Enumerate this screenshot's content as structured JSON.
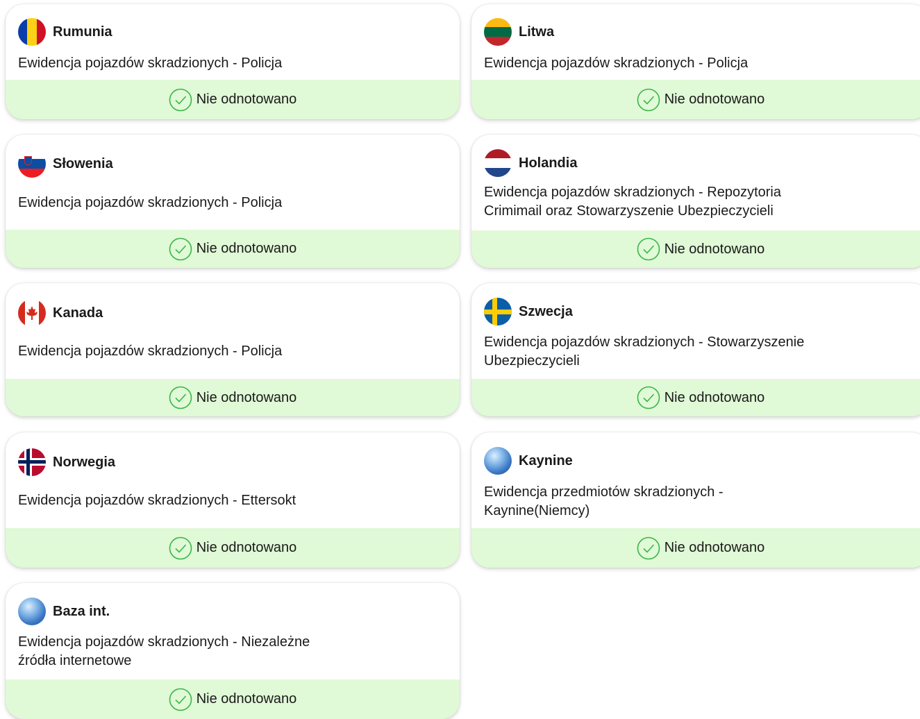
{
  "status_label": "Nie odnotowano",
  "colors": {
    "status_bg": "#e0f9d6",
    "check": "#3bb54a"
  },
  "cards": [
    {
      "country": "Rumunia",
      "flag": "romania",
      "desc": "Ewidencja pojazdów skradzionych - Policja"
    },
    {
      "country": "Litwa",
      "flag": "lithuania",
      "desc": "Ewidencja pojazdów skradzionych - Policja"
    },
    {
      "country": "Słowenia",
      "flag": "slovenia",
      "desc": "Ewidencja pojazdów skradzionych - Policja"
    },
    {
      "country": "Holandia",
      "flag": "netherlands",
      "desc": "Ewidencja pojazdów skradzionych - Repozytoria Crimimail oraz Stowarzyszenie Ubezpieczycieli"
    },
    {
      "country": "Kanada",
      "flag": "canada",
      "desc": "Ewidencja pojazdów skradzionych - Policja"
    },
    {
      "country": "Szwecja",
      "flag": "sweden",
      "desc": "Ewidencja pojazdów skradzionych - Stowarzyszenie Ubezpieczycieli"
    },
    {
      "country": "Norwegia",
      "flag": "norway",
      "desc": "Ewidencja pojazdów skradzionych - Ettersokt"
    },
    {
      "country": "Kaynine",
      "flag": "globe",
      "desc": "Ewidencja przedmiotów skradzionych - Kaynine(Niemcy)"
    },
    {
      "country": "Baza int.",
      "flag": "globe",
      "desc": "Ewidencja pojazdów skradzionych - Niezależne źródła internetowe"
    }
  ]
}
